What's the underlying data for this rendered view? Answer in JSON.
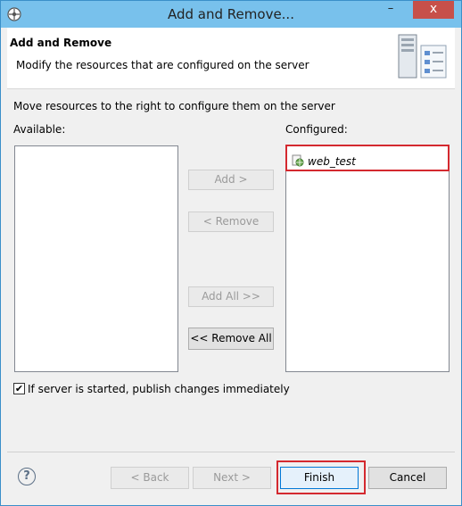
{
  "window": {
    "title": "Add and Remove...",
    "close_glyph": "x",
    "minimize_glyph": "–"
  },
  "header": {
    "title": "Add and Remove",
    "subtitle": "Modify the resources that are configured on the server",
    "icon": "server-banner-icon"
  },
  "body": {
    "instruction": "Move resources to the right to configure them on the server",
    "available_label": "Available:",
    "configured_label": "Configured:",
    "configured_items": [
      {
        "label": "web_test",
        "icon": "web-module-icon"
      }
    ]
  },
  "actions": {
    "add": "Add >",
    "remove": "< Remove",
    "add_all": "Add All >>",
    "remove_all": "<< Remove All"
  },
  "options": {
    "publish_immediately": {
      "label": "If server is started, publish changes immediately",
      "checked": true
    }
  },
  "footer": {
    "help": "?",
    "back": "< Back",
    "next": "Next >",
    "finish": "Finish",
    "cancel": "Cancel"
  },
  "colors": {
    "highlight": "#d4292f",
    "titlebar": "#78c1ec",
    "close": "#c7504a"
  }
}
